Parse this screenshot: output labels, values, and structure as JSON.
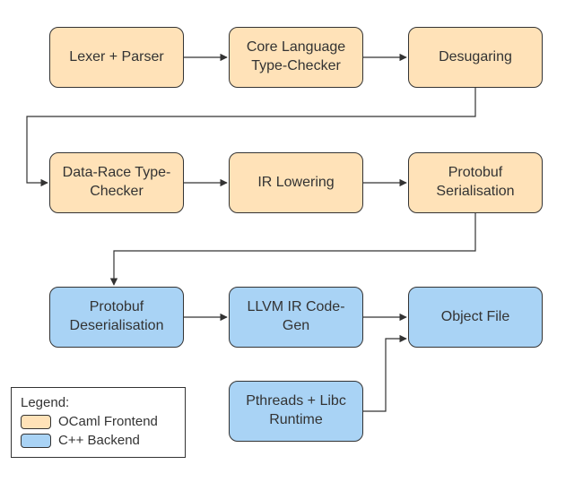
{
  "colors": {
    "ocaml": "#ffe2b8",
    "cpp": "#a9d3f5"
  },
  "nodes": {
    "lexer_parser": "Lexer + Parser",
    "core_type_checker": "Core Language\nType-Checker",
    "desugaring": "Desugaring",
    "data_race_checker": "Data-Race\nType-Checker",
    "ir_lowering": "IR Lowering",
    "protobuf_serial": "Protobuf\nSerialisation",
    "protobuf_deserial": "Protobuf\nDeserialisation",
    "llvm_codegen": "LLVM IR\nCode-Gen",
    "object_file": "Object File",
    "pthreads_runtime": "Pthreads + Libc\nRuntime"
  },
  "legend": {
    "title": "Legend:",
    "ocaml": "OCaml Frontend",
    "cpp": "C++ Backend"
  },
  "edges": [
    {
      "from": "lexer_parser",
      "to": "core_type_checker"
    },
    {
      "from": "core_type_checker",
      "to": "desugaring"
    },
    {
      "from": "desugaring",
      "to": "data_race_checker"
    },
    {
      "from": "data_race_checker",
      "to": "ir_lowering"
    },
    {
      "from": "ir_lowering",
      "to": "protobuf_serial"
    },
    {
      "from": "protobuf_serial",
      "to": "protobuf_deserial"
    },
    {
      "from": "protobuf_deserial",
      "to": "llvm_codegen"
    },
    {
      "from": "llvm_codegen",
      "to": "object_file"
    },
    {
      "from": "pthreads_runtime",
      "to": "object_file"
    }
  ]
}
